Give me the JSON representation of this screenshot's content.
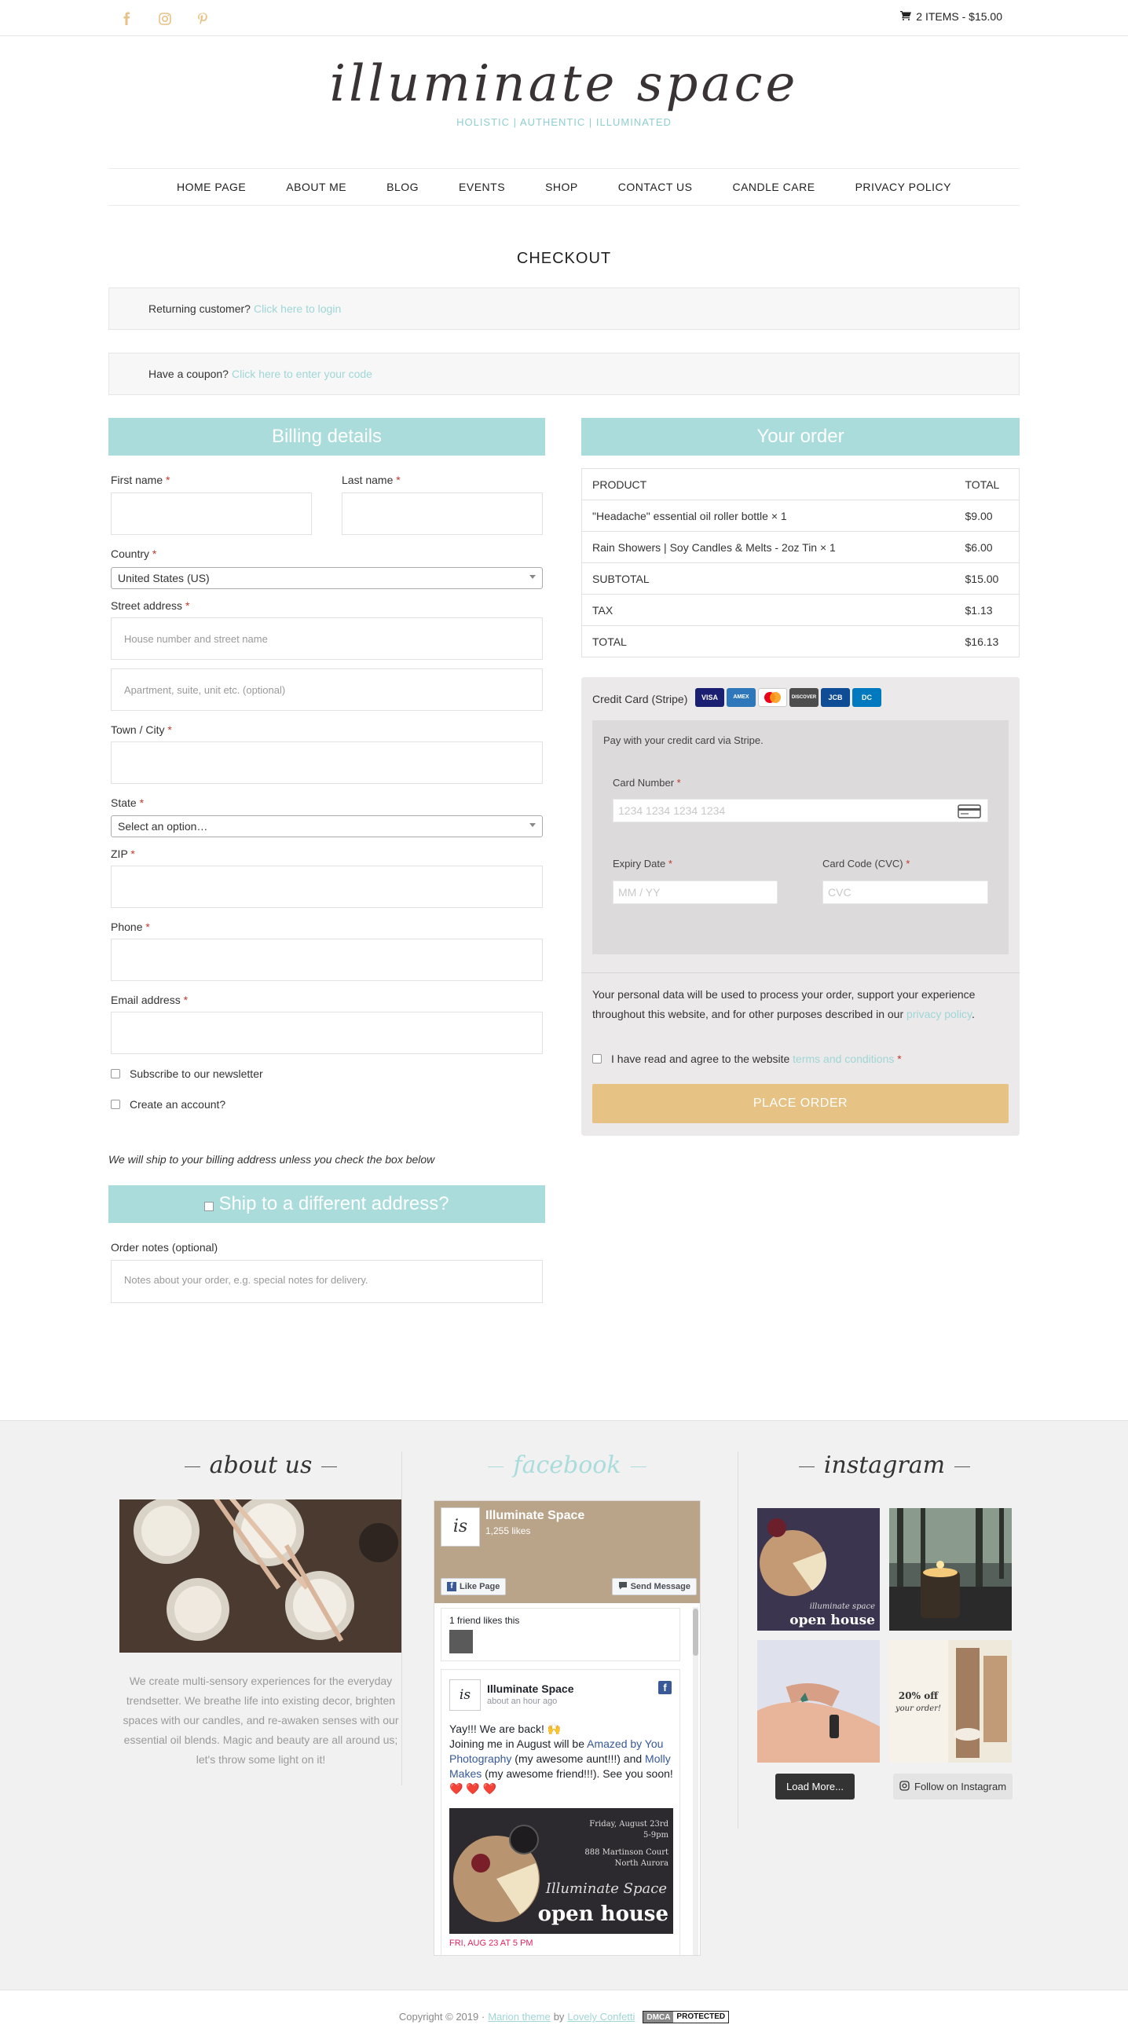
{
  "topbar": {
    "social_icons": [
      "facebook-icon",
      "instagram-icon",
      "pinterest-icon"
    ],
    "cart_text": "2 ITEMS - $15.00"
  },
  "header": {
    "logo": "illuminate space",
    "tagline": "HOLISTIC | AUTHENTIC | ILLUMINATED"
  },
  "nav": [
    "HOME PAGE",
    "ABOUT ME",
    "BLOG",
    "EVENTS",
    "SHOP",
    "CONTACT US",
    "CANDLE CARE",
    "PRIVACY POLICY"
  ],
  "page": {
    "title": "CHECKOUT",
    "returning_text": "Returning customer?",
    "returning_link": "Click here to login",
    "coupon_text": "Have a coupon?",
    "coupon_link": "Click here to enter your code"
  },
  "billing": {
    "heading": "Billing details",
    "first_name_label": "First name",
    "last_name_label": "Last name",
    "country_label": "Country",
    "country_value": "United States (US)",
    "street_label": "Street address",
    "street_placeholder": "House number and street name",
    "apt_placeholder": "Apartment, suite, unit etc. (optional)",
    "town_label": "Town / City",
    "state_label": "State",
    "state_value": "Select an option…",
    "zip_label": "ZIP",
    "phone_label": "Phone",
    "email_label": "Email address",
    "required_mark": "*",
    "newsletter_label": "Subscribe to our newsletter",
    "account_label": "Create an account?",
    "ship_note": "We will ship to your billing address unless you check the box below",
    "ship_heading": "Ship to a different address?",
    "notes_label": "Order notes (optional)",
    "notes_placeholder": "Notes about your order, e.g. special notes for delivery."
  },
  "order": {
    "heading": "Your order",
    "col_product": "PRODUCT",
    "col_total": "TOTAL",
    "items": [
      {
        "name": "\"Headache\" essential oil roller bottle  × 1",
        "total": "$9.00"
      },
      {
        "name": "Rain Showers | Soy Candles & Melts - 2oz Tin  × 1",
        "total": "$6.00"
      }
    ],
    "subtotal_label": "SUBTOTAL",
    "subtotal": "$15.00",
    "tax_label": "TAX",
    "tax": "$1.13",
    "total_label": "TOTAL",
    "total": "$16.13"
  },
  "payment": {
    "method": "Credit Card (Stripe)",
    "card_brands": [
      "VISA",
      "AMEX",
      "MC",
      "DISCOVER",
      "JCB",
      "DC"
    ],
    "description": "Pay with your credit card via Stripe.",
    "card_number_label": "Card Number",
    "card_number_placeholder": "1234 1234 1234 1234",
    "expiry_label": "Expiry Date",
    "expiry_placeholder": "MM / YY",
    "cvc_label": "Card Code (CVC)",
    "cvc_placeholder": "CVC",
    "privacy_text": "Your personal data will be used to process your order, support your experience throughout this website, and for other purposes described in our",
    "privacy_link": "privacy policy",
    "terms_text": "I have read and agree to the website",
    "terms_link": "terms and conditions",
    "place_order": "PLACE ORDER"
  },
  "footer": {
    "about_title": "about us",
    "about_text": "We create multi-sensory experiences for the everyday trendsetter. We breathe life into existing decor, brighten spaces with our candles, and re-awaken senses with our essential oil blends. Magic and beauty are all around us; let's throw some light on it!",
    "facebook_title": "facebook",
    "fb_page_name": "Illuminate Space",
    "fb_likes": "1,255 likes",
    "fb_like_btn": "Like Page",
    "fb_send_btn": "Send Message",
    "fb_friend_text": "1 friend likes this",
    "fb_post_author": "Illuminate Space",
    "fb_post_time": "about an hour ago",
    "fb_post_line1": "Yay!!! We are back! 🙌",
    "fb_post_line2": "Joining me in August will be",
    "fb_post_link1": "Amazed by You Photography",
    "fb_post_line3": "(my awesome aunt!!!) and",
    "fb_post_link2": "Molly Makes",
    "fb_post_line4": "(my awesome friend!!!). See you soon! ❤️ ❤️ ❤️",
    "fb_photo_date": "Friday, August 23rd",
    "fb_photo_time": "5-9pm",
    "fb_photo_addr1": "888 Martinson Court",
    "fb_photo_addr2": "North Aurora",
    "fb_photo_title": "open house",
    "fb_event_date": "FRI, AUG 23 AT 5 PM",
    "instagram_title": "instagram",
    "ig_load_more": "Load More...",
    "ig_follow": "Follow on Instagram",
    "copyright_text": "Copyright © 2019 ·",
    "theme_link": "Marion theme",
    "by_text": "by",
    "author_link": "Lovely Confetti",
    "dmca_left": "DMCA",
    "dmca_right": "PROTECTED"
  },
  "colors": {
    "accent": "#a9dcdb",
    "link": "#9fd6d6",
    "button": "#e6c285",
    "required": "#c0392b"
  }
}
